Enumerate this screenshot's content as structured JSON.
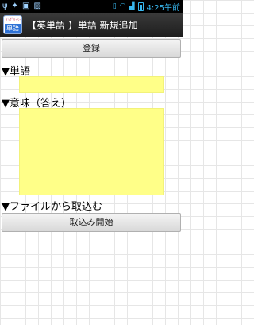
{
  "statusbar": {
    "left_icons": [
      "usb-icon",
      "android-icon",
      "lock-icon",
      "image-icon"
    ],
    "time": "4:25午前"
  },
  "app": {
    "icon_top_text": "ｲﾝｸﾞﾘｯｼｭ",
    "icon_bottom_text": "単語",
    "title": "【英単語 】単語 新規追加"
  },
  "form": {
    "register_button": "登録",
    "word_label": "▼単語",
    "word_value": "",
    "meaning_label": "▼意味（答え）",
    "meaning_value": "",
    "import_label": "▼ファイルから取込む",
    "import_button": "取込み開始"
  },
  "colors": {
    "field_bg": "#ffff88",
    "titlebar_bg": "#2a2a2a",
    "status_accent": "#38b7ee"
  }
}
